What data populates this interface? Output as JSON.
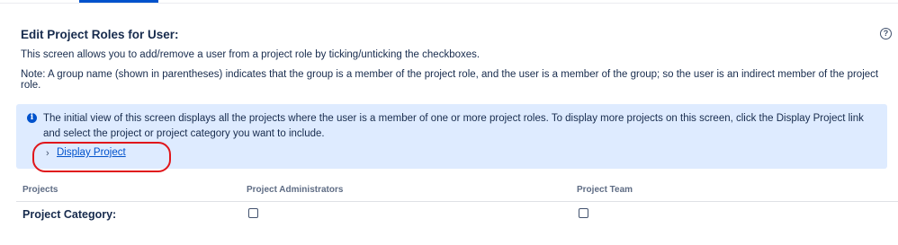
{
  "page": {
    "title": "Edit Project Roles for User:",
    "description": "This screen allows you to add/remove a user from a project role by ticking/unticking the checkboxes.",
    "note": "Note: A group name (shown in parentheses) indicates that the group is a member of the project role, and the user is a member of the group; so the user is an indirect member of the project role.",
    "help_icon": "?"
  },
  "info_panel": {
    "icon": "i",
    "message": "The initial view of this screen displays all the projects where the user is a member of one or more project roles. To display more projects on this screen, click the Display Project link and select the project or project category you want to include.",
    "link_chevron": "›",
    "link_label": "Display Project"
  },
  "table": {
    "headers": [
      "Projects",
      "Project Administrators",
      "Project Team"
    ],
    "rows": [
      {
        "label": "Project Category:",
        "administrators_checked": false,
        "team_checked": false
      }
    ]
  },
  "colors": {
    "accent": "#0052cc",
    "info_background": "#deebff",
    "highlight": "#e0161b"
  }
}
